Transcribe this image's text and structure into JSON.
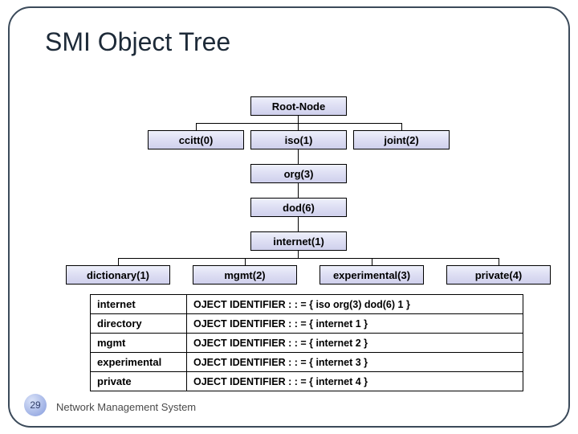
{
  "title": "SMI Object Tree",
  "tree": {
    "root": "Root-Node",
    "ccitt": "ccitt(0)",
    "iso": "iso(1)",
    "joint": "joint(2)",
    "org": "org(3)",
    "dod": "dod(6)",
    "internet": "internet(1)",
    "dictionary": "dictionary(1)",
    "mgmt": "mgmt(2)",
    "experimental": "experimental(3)",
    "private": "private(4)"
  },
  "defs": [
    {
      "name": "internet",
      "value": "OJECT IDENTIFIER : : = { iso org(3) dod(6) 1 }"
    },
    {
      "name": "directory",
      "value": "OJECT IDENTIFIER : : = { internet 1 }"
    },
    {
      "name": "mgmt",
      "value": "OJECT IDENTIFIER : : = { internet 2 }"
    },
    {
      "name": "experimental",
      "value": "OJECT IDENTIFIER : : = { internet 3 }"
    },
    {
      "name": "private",
      "value": "OJECT IDENTIFIER : : = { internet 4 }"
    }
  ],
  "page_number": "29",
  "footer": "Network Management System"
}
